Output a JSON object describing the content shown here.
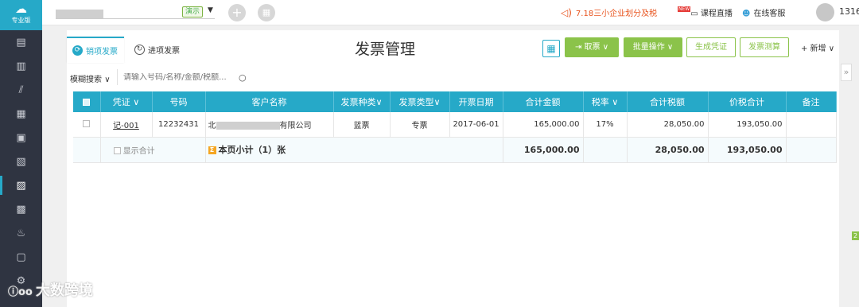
{
  "sidebar": {
    "brand_logo": "☁",
    "brand_label": "专业版",
    "icons": [
      "ledger-icon",
      "document-icon",
      "chart-icon",
      "building-icon",
      "calendar-icon",
      "book-icon",
      "invoice-icon",
      "image-icon",
      "stamp-icon",
      "report-icon",
      "settings-icon"
    ],
    "active_index": 6
  },
  "header": {
    "demo_tag": "演示",
    "notice": "7.18三小企业划分及税",
    "course_badge": "NEW",
    "course_label": "课程直播",
    "service_label": "在线客服",
    "username": "1316"
  },
  "tabs": [
    {
      "label": "销项发票",
      "icon": "sales-icon",
      "active": true
    },
    {
      "label": "进项发票",
      "icon": "purchase-icon",
      "active": false
    }
  ],
  "page_title": "发票管理",
  "toolbar": {
    "fetch_label": "取票",
    "batch_label": "批量操作",
    "voucher_label": "生成凭证",
    "tax_calc_label": "发票测算",
    "add_label": "+ 新增"
  },
  "search": {
    "mode_label": "模糊搜索",
    "placeholder": "请输入号码/名称/金额/税额..."
  },
  "table": {
    "headers": [
      "凭证",
      "号码",
      "客户名称",
      "发票种类",
      "发票类型",
      "开票日期",
      "合计金额",
      "税率",
      "合计税额",
      "价税合计",
      "备注"
    ],
    "rows": [
      {
        "voucher": "记-001",
        "number": "12232431",
        "customer_prefix": "北",
        "customer_suffix": "有限公司",
        "kind": "蓝票",
        "type": "专票",
        "date": "2017-06-01",
        "amount": "165,000.00",
        "rate": "17%",
        "tax": "28,050.00",
        "total": "193,050.00",
        "note": ""
      }
    ],
    "subtotal": {
      "show_total_label": "显示合计",
      "label": "本页小计（1）张",
      "amount": "165,000.00",
      "tax": "28,050.00",
      "total": "193,050.00"
    }
  },
  "right_edge": {
    "collapse_glyph": "»",
    "badge": "2"
  },
  "watermark": {
    "mark": "ⓘoo",
    "text": "大数跨境"
  },
  "colors": {
    "accent": "#26a9c8",
    "green": "#8bc34a",
    "sidebar": "#2f3441",
    "notice": "#e8541e"
  }
}
